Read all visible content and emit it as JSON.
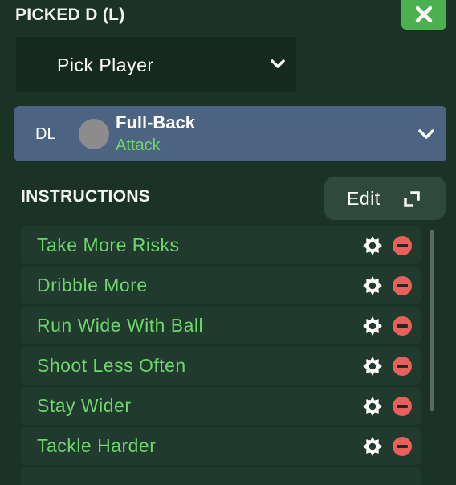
{
  "header": {
    "title": "PICKED D (L)"
  },
  "close": {
    "icon": "close-icon"
  },
  "pick_player": {
    "label": "Pick Player",
    "icon": "chevron-down-icon"
  },
  "role_card": {
    "position": "DL",
    "role": "Full-Back",
    "duty": "Attack",
    "duty_color": "#6ed66a",
    "background": "#4c6482"
  },
  "instructions": {
    "heading": "INSTRUCTIONS",
    "edit_label": "Edit",
    "items": [
      {
        "label": "Take More Risks"
      },
      {
        "label": "Dribble More"
      },
      {
        "label": "Run Wide With Ball"
      },
      {
        "label": "Shoot Less Often"
      },
      {
        "label": "Stay Wider"
      },
      {
        "label": "Tackle Harder"
      }
    ]
  },
  "colors": {
    "background": "#1a3326",
    "accent_green": "#4caf50",
    "instruction_text": "#6ed66a",
    "remove_red": "#e8605a"
  }
}
